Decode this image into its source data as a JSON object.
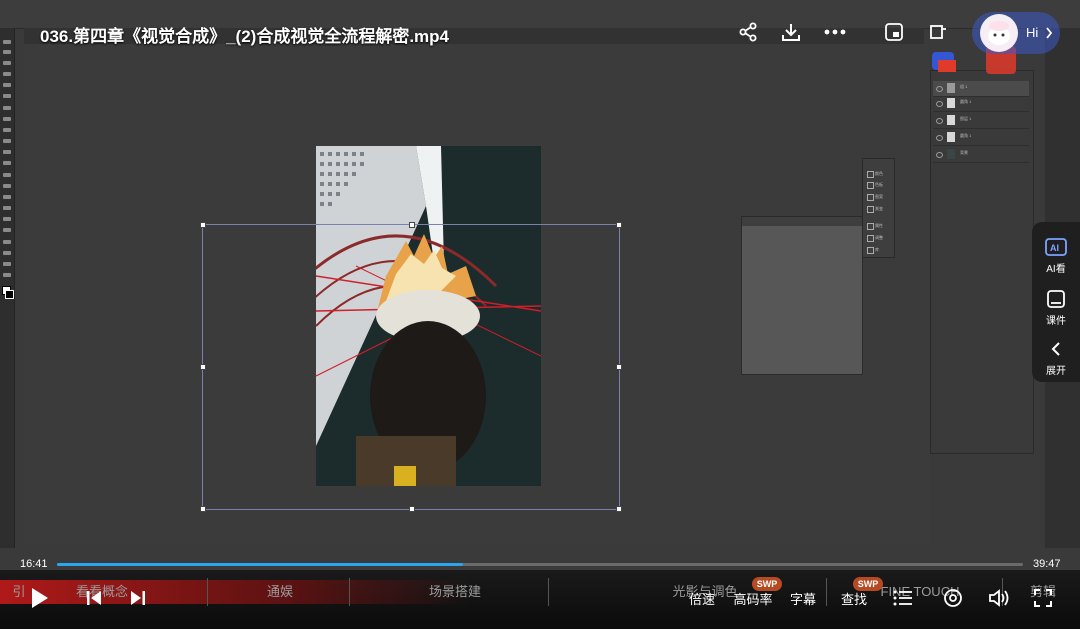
{
  "video": {
    "title": "036.第四章《视觉合成》_(2)合成视觉全流程解密.mp4",
    "time_current": "16:41",
    "time_total": "39:47",
    "progress": 0.42,
    "colors": {
      "progress": "#2aa5f2",
      "accent": "#b64a22"
    }
  },
  "top_actions": {
    "share_icon": "share-icon",
    "download_icon": "download-icon",
    "more_icon": "more-icon",
    "pip_icon": "pip-icon",
    "mini_window_icon": "mini-window-icon"
  },
  "assistant": {
    "hi": "Hi"
  },
  "side_panel": {
    "items": [
      {
        "label": "AI看",
        "icon": "ai-icon"
      },
      {
        "label": "课件",
        "icon": "courseware-icon"
      },
      {
        "label": "展开",
        "icon": "chevron-left-icon"
      }
    ]
  },
  "chapters": [
    "引",
    "看看概念",
    "通娱",
    "场景搭建",
    "光影与调色",
    "FINE TOUCH",
    "剪辑"
  ],
  "controls": {
    "speed": "倍速",
    "quality": "高码率",
    "subtitles": "字幕",
    "search": "查找",
    "swp_badge": "SWP"
  },
  "photoshop": {
    "layers": [
      "组 1",
      "圆角 1",
      "图层 1",
      "圆角 1",
      "背景"
    ],
    "mini_panel_items": [
      "颜色",
      "色板",
      "图案",
      "渐变",
      "属性",
      "调整",
      "库"
    ]
  }
}
